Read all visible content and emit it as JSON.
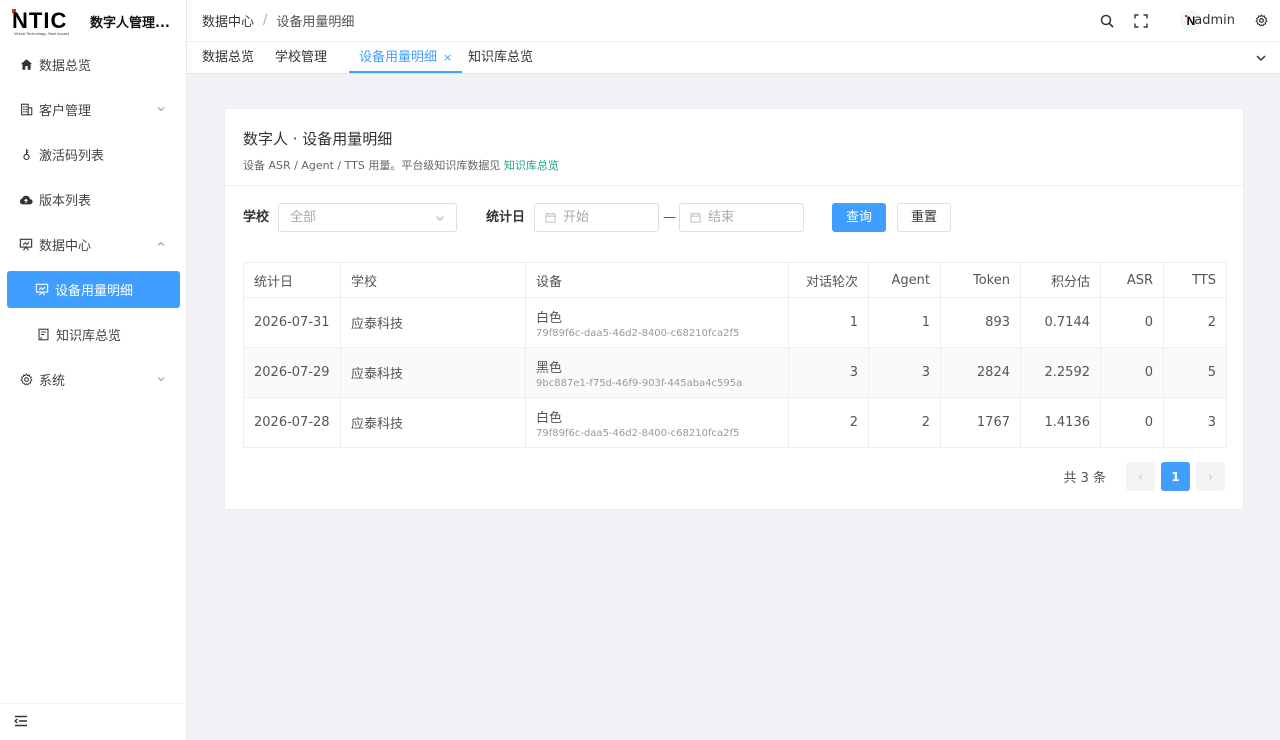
{
  "app": {
    "logo_text": "NTIC",
    "logo_tagline": "Virtual Technology, Real Impact",
    "title": "数字人管理..."
  },
  "sidebar": {
    "items": [
      {
        "label": "数据总览",
        "icon": "home-icon"
      },
      {
        "label": "客户管理",
        "icon": "building-icon"
      },
      {
        "label": "激活码列表",
        "icon": "key-icon"
      },
      {
        "label": "版本列表",
        "icon": "cloud-upload-icon"
      },
      {
        "label": "数据中心",
        "icon": "presentation-icon"
      },
      {
        "label": "系统",
        "icon": "gear-icon"
      }
    ],
    "sub_items": [
      {
        "label": "设备用量明细",
        "icon": "presentation-icon",
        "active": true
      },
      {
        "label": "知识库总览",
        "icon": "book-icon",
        "active": false
      }
    ]
  },
  "header": {
    "breadcrumb": [
      "数据中心",
      "设备用量明细"
    ],
    "breadcrumb_sep": "/",
    "username": "admin",
    "avatar_letter": "N"
  },
  "tabs": [
    {
      "label": "数据总览"
    },
    {
      "label": "学校管理"
    },
    {
      "label": "设备用量明细",
      "active": true,
      "close": "×"
    },
    {
      "label": "知识库总览"
    }
  ],
  "card": {
    "title": "数字人 · 设备用量明细",
    "subtitle": "设备 ASR / Agent / TTS 用量。平台级知识库数据见",
    "subtitle_link": "知识库总览"
  },
  "filters": {
    "school_label": "学校",
    "school_value": "全部",
    "date_label": "统计日",
    "start_placeholder": "开始",
    "end_placeholder": "结束",
    "range_sep": "—",
    "query_button": "查询",
    "reset_button": "重置"
  },
  "table": {
    "columns": [
      "统计日",
      "学校",
      "设备",
      "对话轮次",
      "Agent",
      "Token",
      "积分估",
      "ASR",
      "TTS"
    ],
    "rows": [
      {
        "date": "2026-07-31",
        "school": "应泰科技",
        "device_name": "白色",
        "device_id": "79f89f6c-daa5-46d2-8400-c68210fca2f5",
        "turns": "1",
        "agent": "1",
        "token": "893",
        "points": "0.7144",
        "asr": "0",
        "tts": "2"
      },
      {
        "date": "2026-07-29",
        "school": "应泰科技",
        "device_name": "黑色",
        "device_id": "9bc887e1-f75d-46f9-903f-445aba4c595a",
        "turns": "3",
        "agent": "3",
        "token": "2824",
        "points": "2.2592",
        "asr": "0",
        "tts": "5"
      },
      {
        "date": "2026-07-28",
        "school": "应泰科技",
        "device_name": "白色",
        "device_id": "79f89f6c-daa5-46d2-8400-c68210fca2f5",
        "turns": "2",
        "agent": "2",
        "token": "1767",
        "points": "1.4136",
        "asr": "0",
        "tts": "3"
      }
    ]
  },
  "pagination": {
    "total_text": "共 3 条",
    "current_page": "1",
    "prev": "‹",
    "next": "›"
  },
  "colors": {
    "primary": "#409eff",
    "link": "#13a88a"
  }
}
